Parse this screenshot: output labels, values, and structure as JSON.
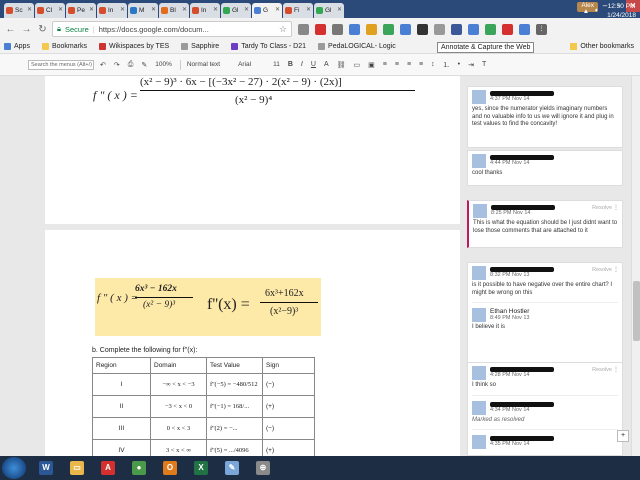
{
  "tabs": [
    {
      "label": "Sc",
      "color": "#d64d2c"
    },
    {
      "label": "Cl",
      "color": "#d64d2c"
    },
    {
      "label": "Pe",
      "color": "#d64d2c"
    },
    {
      "label": "In",
      "color": "#d64d2c"
    },
    {
      "label": "M",
      "color": "#2a78c4"
    },
    {
      "label": "Bl",
      "color": "#e06c1c"
    },
    {
      "label": "In",
      "color": "#d64d2c"
    },
    {
      "label": "Gl",
      "color": "#33a852"
    },
    {
      "label": "G",
      "color": "#4a7fd4",
      "active": true
    },
    {
      "label": "Fi",
      "color": "#d64d2c"
    },
    {
      "label": "Gl",
      "color": "#33a852"
    }
  ],
  "user_chip": "Alex",
  "address": {
    "secure_label": "Secure",
    "url": "https://docs.google.com/docum..."
  },
  "bookmarks": [
    {
      "label": "Apps",
      "color": "#4a7fd4"
    },
    {
      "label": "Bookmarks",
      "color": "#f2c94c"
    },
    {
      "label": "Wikispaces by TES",
      "color": "#cc3333"
    },
    {
      "label": "Sapphire",
      "color": "#9a9a9a"
    },
    {
      "label": "Tardy To Class - D21",
      "color": "#6f3cc4"
    },
    {
      "label": "PedaLOGICAL- Logic",
      "color": "#9a9a9a"
    }
  ],
  "tooltip": "Annotate & Capture the Web",
  "other_bookmarks": "Other bookmarks",
  "docs_toolbar": {
    "menu_search_placeholder": "Search the menus (Alt+/)",
    "zoom": "100%",
    "style": "Normal text",
    "font": "Arial",
    "size": "11"
  },
  "doc": {
    "eq1": {
      "fx": "f \" ( x ) =",
      "numerator": "(x² − 9)³ · 6x − [(−3x² − 27) · 2(x² − 9) · (2x)]",
      "denominator": "(x² − 9)⁴"
    },
    "eq2": {
      "fx": "f \" ( x ) =",
      "numerator": "6x³ − 162x",
      "denominator": "(x² − 9)³",
      "big_fx": "f''(x) =",
      "big_numerator": "6x³+162x",
      "big_denominator": "(x²−9)³"
    },
    "instruction": "b. Complete the following for f''(x):",
    "table": {
      "headers": [
        "Region",
        "Domain",
        "Test Value",
        "Sign"
      ],
      "rows": [
        {
          "region": "I",
          "domain": "−∞ < x < −3",
          "test": "f''(−5) = −480/512",
          "sign": "(−)"
        },
        {
          "region": "II",
          "domain": "−3 < x < 0",
          "test": "f''(−1) = 168/...",
          "sign": "(+)"
        },
        {
          "region": "III",
          "domain": "0 < x < 3",
          "test": "f''(2) = −...",
          "sign": "(−)"
        },
        {
          "region": "IV",
          "domain": "3 < x < ∞",
          "test": "f''(5) = .../4096",
          "sign": "(+)"
        }
      ]
    }
  },
  "comments": [
    {
      "time": "4:37 PM Nov 14",
      "text": "yes, since the numerator yields imaginary numbers and no valuable info to us we will ignore it and plug in test values to find the concavity!",
      "redacted": true
    },
    {
      "time": "4:44 PM Nov 14",
      "text": "cool thanks",
      "redacted": true
    },
    {
      "time": "8:25 PM Nov 14",
      "text": "This is what the equation should be I just didnt want to lose those comments that are attached to it",
      "resolve": "Resolve",
      "redacted": true,
      "active": true
    },
    {
      "time": "8:32 PM Nov 13",
      "text": "is it possible to have negative over the entire chart? I might be wrong on this",
      "resolve": "Resolve",
      "redacted": true
    },
    {
      "name": "Ethan Hostler",
      "time": "8:49 PM Nov 13",
      "text": "I believe it is",
      "redacted": false
    },
    {
      "time": "4:28 PM Nov 14",
      "text": "I think so",
      "resolve": "Resolve",
      "redacted": true
    },
    {
      "time": "4:34 PM Nov 14",
      "text": "Marked as resolved",
      "redacted": true,
      "muted": true
    },
    {
      "time": "4:35 PM Nov 14",
      "text": "",
      "redacted": true
    }
  ],
  "taskbar": {
    "apps": [
      {
        "name": "word",
        "glyph": "W",
        "color": "#2b5797"
      },
      {
        "name": "explorer",
        "glyph": "▭",
        "color": "#e8b84a"
      },
      {
        "name": "acrobat",
        "glyph": "A",
        "color": "#d3302f"
      },
      {
        "name": "chrome",
        "glyph": "●",
        "color": "#4a9a4a"
      },
      {
        "name": "outlook",
        "glyph": "O",
        "color": "#e07b1c"
      },
      {
        "name": "excel",
        "glyph": "X",
        "color": "#217346"
      },
      {
        "name": "paint",
        "glyph": "✎",
        "color": "#7aa6d8"
      },
      {
        "name": "network",
        "glyph": "⊕",
        "color": "#8a8a8a"
      }
    ],
    "time": "12:50 PM",
    "date": "1/24/2018"
  }
}
